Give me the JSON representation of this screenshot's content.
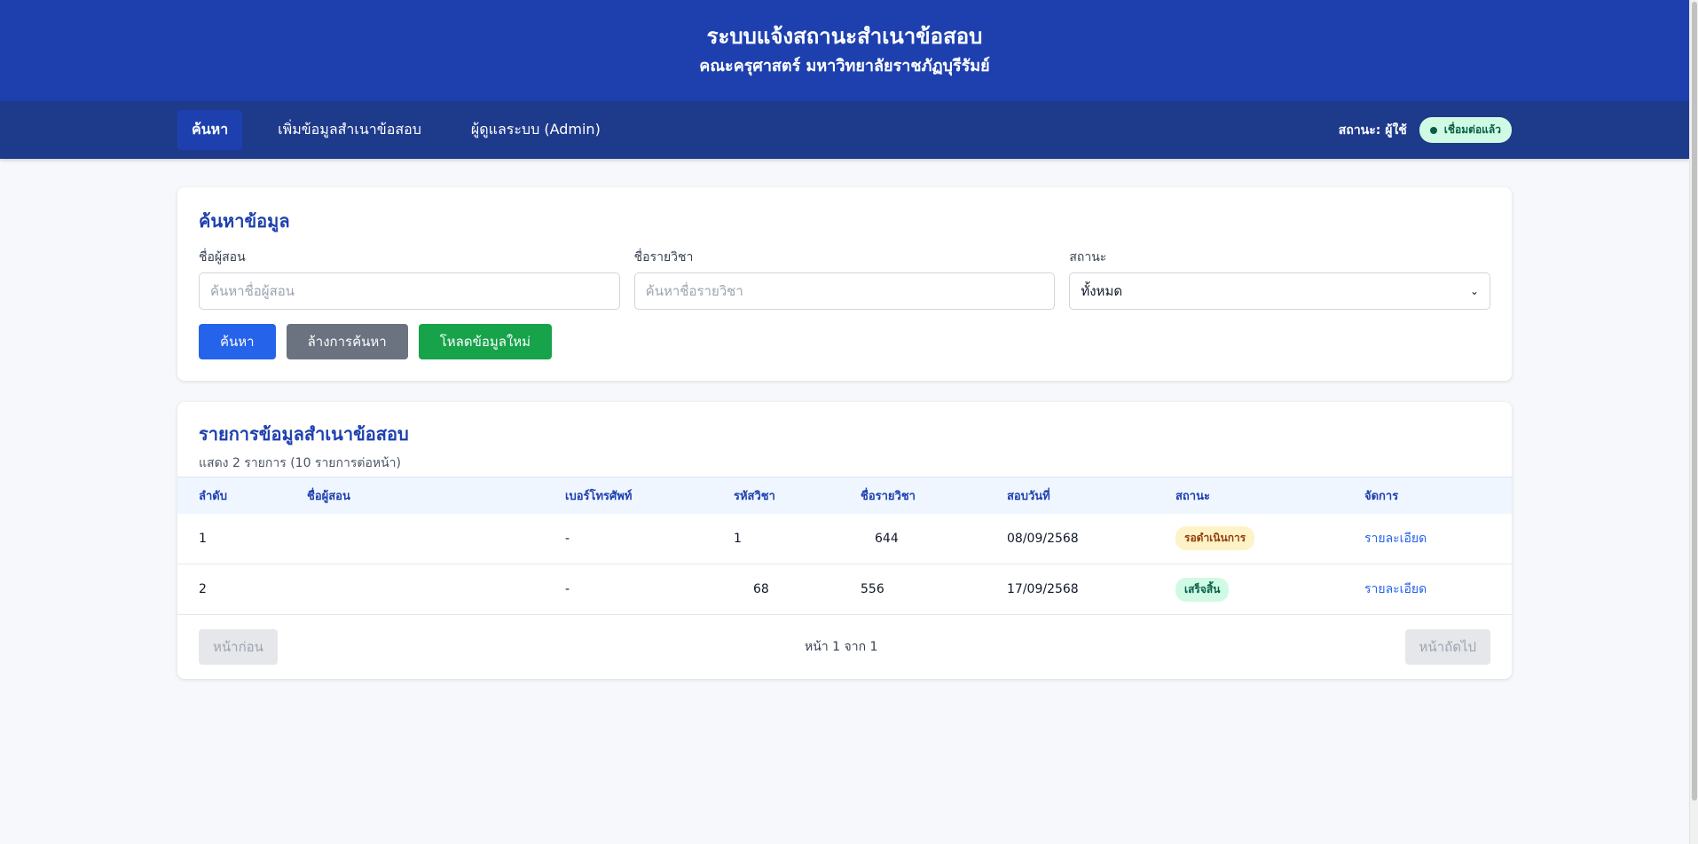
{
  "header": {
    "title": "ระบบแจ้งสถานะสำเนาข้อสอบ",
    "subtitle": "คณะครุศาสตร์ มหาวิทยาลัยราชภัฏบุรีรัมย์"
  },
  "nav": {
    "items": [
      {
        "label": "ค้นหา",
        "active": true
      },
      {
        "label": "เพิ่มข้อมูลสำเนาข้อสอบ",
        "active": false
      },
      {
        "label": "ผู้ดูแลระบบ (Admin)",
        "active": false
      }
    ],
    "status_label": "สถานะ: ผู้ใช้",
    "connection_badge": "เชื่อมต่อแล้ว"
  },
  "search": {
    "title": "ค้นหาข้อมูล",
    "instructor_label": "ชื่อผู้สอน",
    "instructor_placeholder": "ค้นหาชื่อผู้สอน",
    "subject_label": "ชื่อรายวิชา",
    "subject_placeholder": "ค้นหาชื่อรายวิชา",
    "status_label": "สถานะ",
    "status_selected": "ทั้งหมด",
    "search_button": "ค้นหา",
    "clear_button": "ล้างการค้นหา",
    "reload_button": "โหลดข้อมูลใหม่"
  },
  "list": {
    "title": "รายการข้อมูลสำเนาข้อสอบ",
    "summary": "แสดง 2 รายการ (10 รายการต่อหน้า)",
    "columns": [
      "ลำดับ",
      "ชื่อผู้สอน",
      "เบอร์โทรศัพท์",
      "รหัสวิชา",
      "ชื่อรายวิชา",
      "สอบวันที่",
      "สถานะ",
      "จัดการ"
    ],
    "rows": [
      {
        "no": "1",
        "instructor": "",
        "phone": "-",
        "code": "1",
        "subject": "644",
        "date": "08/09/2568",
        "status": "รอดำเนินการ",
        "status_kind": "pending",
        "action": "รายละเอียด"
      },
      {
        "no": "2",
        "instructor": "",
        "phone": "-",
        "code": "68",
        "subject": "556",
        "date": "17/09/2568",
        "status": "เสร็จสิ้น",
        "status_kind": "done",
        "action": "รายละเอียด"
      }
    ],
    "prev_button": "หน้าก่อน",
    "page_info": "หน้า 1 จาก 1",
    "next_button": "หน้าถัดไป"
  },
  "colors": {
    "primary": "#1e40af",
    "nav": "#1e3a8a",
    "accent_blue": "#2563eb",
    "accent_green": "#16a34a",
    "gray_button": "#6b7280"
  }
}
